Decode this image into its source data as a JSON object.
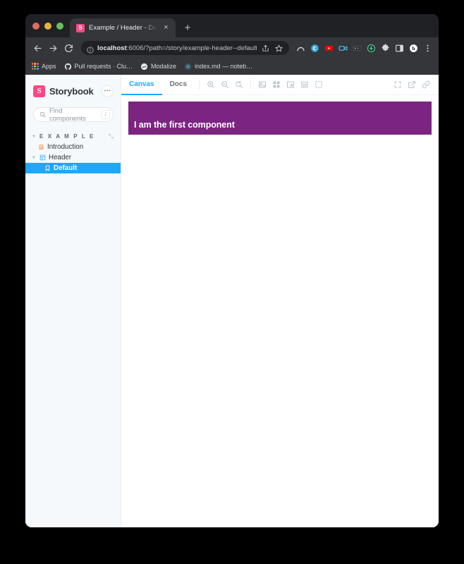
{
  "browser": {
    "tab": {
      "favicon_letter": "S",
      "title": "Example / Header - Default · S",
      "close_label": "×"
    },
    "new_tab_label": "+",
    "omnibox": {
      "host": "localhost",
      "rest": ":6006/?path=/story/example-header--default"
    },
    "bookmarks": [
      {
        "label": "Apps",
        "icon": "apps-grid-icon"
      },
      {
        "label": "Pull requests · Clu…",
        "icon": "github-icon"
      },
      {
        "label": "Modalize",
        "icon": "modalize-icon"
      },
      {
        "label": "index.md — noteb…",
        "icon": "vscode-icon"
      }
    ],
    "extensions": [
      "arc-icon",
      "browser-assistant-icon",
      "youtube-icon",
      "loom-icon",
      "dark-reader-icon",
      "download-icon",
      "puzzle-extension-icon",
      "sidebar-icon",
      "honey-icon",
      "kebab-menu-icon"
    ]
  },
  "storybook": {
    "brand": {
      "logo_letter": "S",
      "name": "Storybook",
      "more_label": "•••"
    },
    "search": {
      "placeholder": "Find components",
      "shortcut": "/"
    },
    "tree": {
      "group_label": "E X A M P L E",
      "items": [
        {
          "label": "Introduction",
          "icon": "document-icon",
          "level": 1,
          "selected": false
        },
        {
          "label": "Header",
          "icon": "component-icon",
          "level": 1,
          "selected": false
        },
        {
          "label": "Default",
          "icon": "story-bookmark-icon",
          "level": 2,
          "selected": true
        }
      ]
    },
    "canvas": {
      "tabs": [
        {
          "label": "Canvas",
          "active": true
        },
        {
          "label": "Docs",
          "active": false
        }
      ],
      "zoom_tools": [
        "zoom-in-icon",
        "zoom-out-icon",
        "zoom-reset-icon"
      ],
      "view_tools": [
        "background-icon",
        "grid-icon",
        "measure-icon",
        "layout-bottom-icon",
        "outline-icon"
      ],
      "right_tools": [
        "fullscreen-icon",
        "open-new-tab-icon",
        "copy-link-icon"
      ]
    },
    "component": {
      "title": "I am the first component",
      "background_color": "#7b2480"
    }
  }
}
